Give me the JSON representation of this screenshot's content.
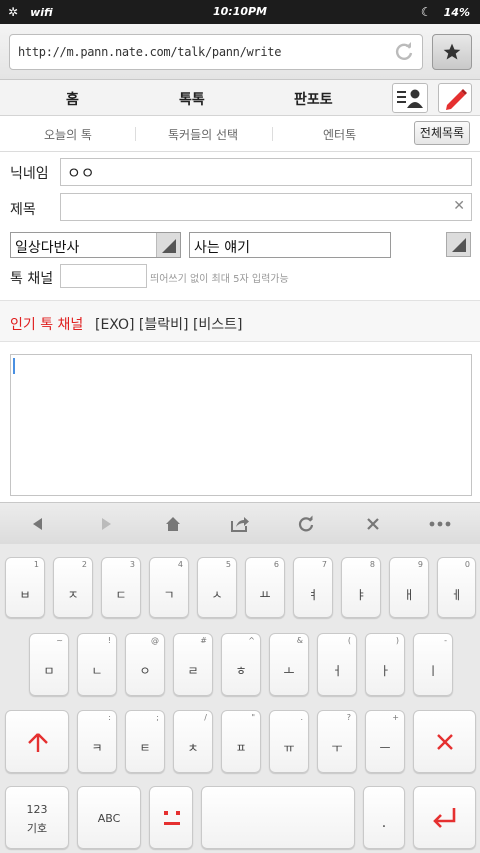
{
  "status": {
    "network": "wifi",
    "time": "10:10PM",
    "battery": "14%"
  },
  "browser": {
    "url": "http://m.pann.nate.com/talk/pann/write"
  },
  "nav": {
    "items": [
      "홈",
      "톡톡",
      "판포토"
    ]
  },
  "subnav": {
    "items": [
      "오늘의 톡",
      "톡커들의 선택",
      "엔터톡"
    ],
    "all_button": "전체목록"
  },
  "form": {
    "nickname_label": "닉네임",
    "nickname_value": "ㅇㅇ",
    "title_label": "제목",
    "title_value": "",
    "category_main": "일상다반사",
    "category_sub": "사는 얘기",
    "channel_label": "톡 채널",
    "channel_value": "",
    "channel_hint": "띄어쓰기 없이 최대 5자 입력가능",
    "popular_label": "인기 톡 채널",
    "popular_tags": "[EXO] [블락비] [비스트]",
    "body_value": ""
  },
  "keyboard": {
    "row1": [
      {
        "main": "ㅂ",
        "sub": "1"
      },
      {
        "main": "ㅈ",
        "sub": "2"
      },
      {
        "main": "ㄷ",
        "sub": "3"
      },
      {
        "main": "ㄱ",
        "sub": "4"
      },
      {
        "main": "ㅅ",
        "sub": "5"
      },
      {
        "main": "ㅛ",
        "sub": "6"
      },
      {
        "main": "ㅕ",
        "sub": "7"
      },
      {
        "main": "ㅑ",
        "sub": "8"
      },
      {
        "main": "ㅐ",
        "sub": "9"
      },
      {
        "main": "ㅔ",
        "sub": "0"
      }
    ],
    "row2": [
      {
        "main": "ㅁ",
        "sub": "~"
      },
      {
        "main": "ㄴ",
        "sub": "!"
      },
      {
        "main": "ㅇ",
        "sub": "@"
      },
      {
        "main": "ㄹ",
        "sub": "#"
      },
      {
        "main": "ㅎ",
        "sub": "^"
      },
      {
        "main": "ㅗ",
        "sub": "&"
      },
      {
        "main": "ㅓ",
        "sub": "("
      },
      {
        "main": "ㅏ",
        "sub": ")"
      },
      {
        "main": "ㅣ",
        "sub": "-"
      }
    ],
    "row3": [
      {
        "main": "ㅋ",
        "sub": ":"
      },
      {
        "main": "ㅌ",
        "sub": ";"
      },
      {
        "main": "ㅊ",
        "sub": "/"
      },
      {
        "main": "ㅍ",
        "sub": "\""
      },
      {
        "main": "ㅠ",
        "sub": "."
      },
      {
        "main": "ㅜ",
        "sub": "?"
      },
      {
        "main": "ㅡ",
        "sub": "+"
      }
    ],
    "numsym_label_1": "123",
    "numsym_label_2": "기호",
    "abc_label": "ABC",
    "period_label": "."
  },
  "colors": {
    "accent_red": "#e53030",
    "caret_blue": "#4a90e2"
  }
}
